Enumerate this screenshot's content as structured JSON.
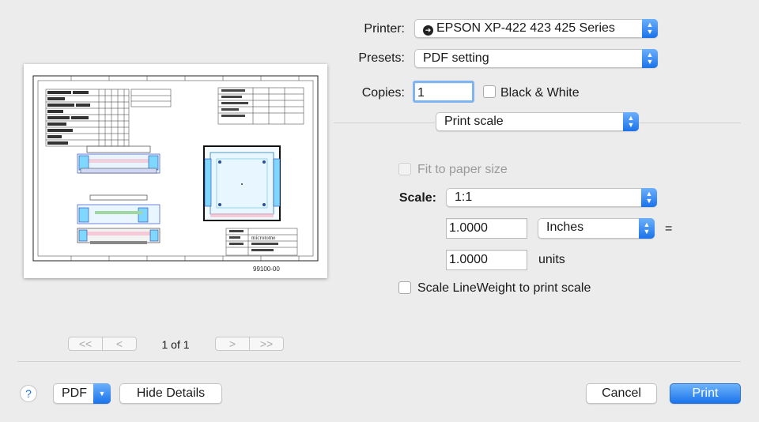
{
  "printer": {
    "label": "Printer:",
    "value": "EPSON XP-422 423 425 Series"
  },
  "presets": {
    "label": "Presets:",
    "value": "PDF setting"
  },
  "copies": {
    "label": "Copies:",
    "value": "1",
    "black_white_label": "Black & White"
  },
  "section_popup": {
    "value": "Print scale"
  },
  "fit_to_paper": {
    "label": "Fit to paper size",
    "checked": false,
    "disabled": true
  },
  "scale": {
    "label": "Scale:",
    "value": "1:1",
    "inches_value": "1.0000",
    "unit_select": "Inches",
    "equals": "=",
    "units_value": "1.0000",
    "units_label": "units"
  },
  "scale_lineweight": {
    "label": "Scale LineWeight to print scale",
    "checked": false
  },
  "preview": {
    "page_indicator": "1 of 1",
    "nav_first": "<<",
    "nav_prev": "<",
    "nav_next": ">",
    "nav_last": ">>",
    "drawing_number": "99100-00",
    "title_block_company": "microtome"
  },
  "footer": {
    "help": "?",
    "pdf": "PDF",
    "hide_details": "Hide Details",
    "cancel": "Cancel",
    "print": "Print"
  },
  "colors": {
    "accent": "#1c74ec",
    "background": "#ececec"
  }
}
